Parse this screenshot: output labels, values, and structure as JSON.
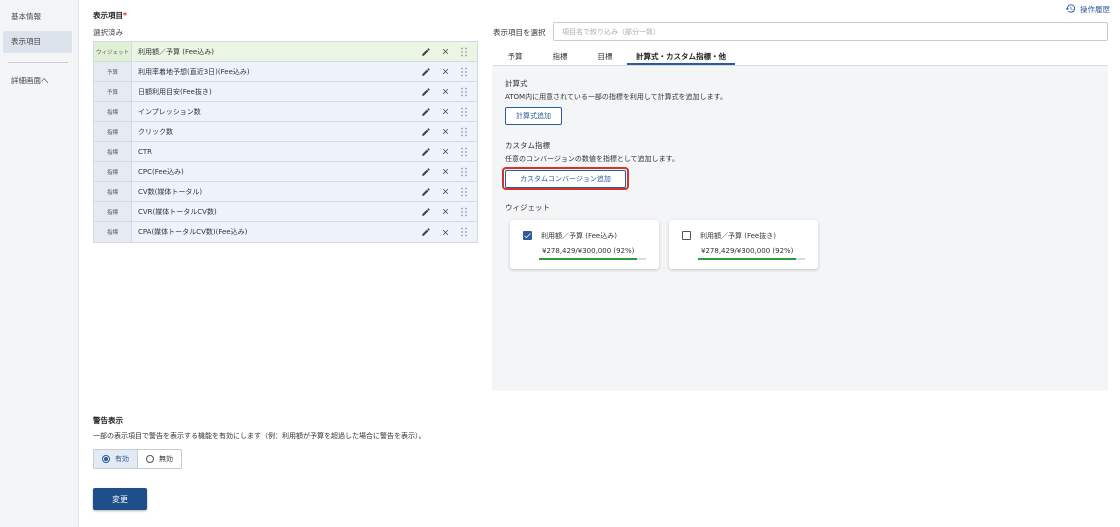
{
  "sidebar": {
    "items": [
      {
        "label": "基本情報"
      },
      {
        "label": "表示項目"
      },
      {
        "label": "詳細画面へ"
      }
    ]
  },
  "header": {
    "history_label": "操作履歴"
  },
  "display_items": {
    "title": "表示項目",
    "required_mark": "*",
    "selected_label": "選択済み",
    "rows": [
      {
        "category": "ウィジェット",
        "label": "利用額／予算 (Fee込み)"
      },
      {
        "category": "予算",
        "label": "利用率着地予想(直近3日)(Fee込み)"
      },
      {
        "category": "予算",
        "label": "日額利用目安(Fee抜き)"
      },
      {
        "category": "指標",
        "label": "インプレッション数"
      },
      {
        "category": "指標",
        "label": "クリック数"
      },
      {
        "category": "指標",
        "label": "CTR"
      },
      {
        "category": "指標",
        "label": "CPC(Fee込み)"
      },
      {
        "category": "指標",
        "label": "CV数(媒体トータル)"
      },
      {
        "category": "指標",
        "label": "CVR(媒体トータルCV数)"
      },
      {
        "category": "指標",
        "label": "CPA(媒体トータルCV数)(Fee込み)"
      }
    ]
  },
  "select_panel": {
    "label": "表示項目を選択",
    "search_placeholder": "項目名で絞り込み（部分一致）",
    "tabs": [
      {
        "label": "予算"
      },
      {
        "label": "指標"
      },
      {
        "label": "目標"
      },
      {
        "label": "計算式・カスタム指標・他"
      }
    ],
    "formula": {
      "title": "計算式",
      "desc": "ATOM内に用意されている一部の指標を利用して計算式を追加します。",
      "button": "計算式追加"
    },
    "custom": {
      "title": "カスタム指標",
      "desc": "任意のコンバージョンの数値を指標として追加します。",
      "button": "カスタムコンバージョン追加"
    },
    "widget": {
      "title": "ウィジェット",
      "cards": [
        {
          "label": "利用額／予算 (Fee込み)",
          "value": "¥278,429/¥300,000 (92%)",
          "checked": true,
          "progress": 0.92
        },
        {
          "label": "利用額／予算 (Fee抜き)",
          "value": "¥278,429/¥300,000 (92%)",
          "checked": false,
          "progress": 0.92
        }
      ]
    }
  },
  "warning": {
    "title": "警告表示",
    "desc": "一部の表示項目で警告を表示する機能を有効にします（例：利用額が予算を超過した場合に警告を表示）。",
    "options": [
      {
        "label": "有効"
      },
      {
        "label": "無効"
      }
    ],
    "selected": 0
  },
  "submit_label": "変更",
  "colors": {
    "accent": "#2b5b9a",
    "highlight": "#d0342c",
    "progress": "#2e9c3a"
  }
}
